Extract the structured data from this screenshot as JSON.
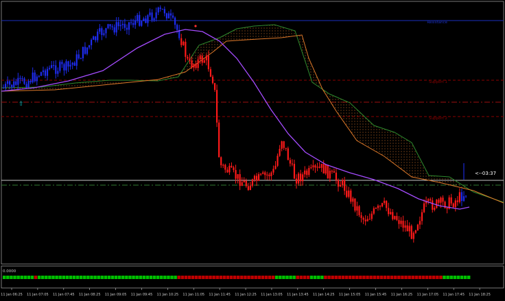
{
  "chart_data": {
    "type": "candlestick",
    "platform_style": "MetaTrader-like dark chart",
    "time_axis_labels": [
      "11 Jan 06:25",
      "11 Jan 07:05",
      "11 Jan 07:45",
      "11 Jan 08:25",
      "11 Jan 09:05",
      "11 Jan 09:45",
      "11 Jan 10:25",
      "11 Jan 11:05",
      "11 Jan 11:45",
      "11 Jan 12:25",
      "11 Jan 13:05",
      "11 Jan 13:45",
      "11 Jan 14:25",
      "11 Jan 15:05",
      "11 Jan 15:45",
      "11 Jan 16:25",
      "11 Jan 17:05",
      "11 Jan 17:45",
      "11 Jan 18:25"
    ],
    "horizontal_lines": [
      {
        "label": "Resistance",
        "color": "#1a2fc0",
        "style": "solid",
        "level": "upper"
      },
      {
        "label": "Support 1",
        "color": "#8b0000",
        "style": "dashed",
        "level": "mid"
      },
      {
        "label": "",
        "color": "#a01010",
        "style": "dashdot",
        "level": "mid2"
      },
      {
        "label": "Support 2",
        "color": "#8b0000",
        "style": "dashed",
        "level": "mid3"
      },
      {
        "label": "",
        "color": "#c8c8c8",
        "style": "solid",
        "level": "current"
      },
      {
        "label": "",
        "color": "#2f7a2f",
        "style": "dashdot",
        "level": "lower"
      }
    ],
    "countdown_label": "<--03:37",
    "indicator_pane": {
      "value_label": "0.0000",
      "segments": [
        {
          "color": "#00c000",
          "count": 9
        },
        {
          "color": "#c00000",
          "count": 1
        },
        {
          "color": "#00c000",
          "count": 40
        },
        {
          "color": "#c00000",
          "count": 28
        },
        {
          "color": "#00c000",
          "count": 6
        },
        {
          "color": "#c00000",
          "count": 4
        },
        {
          "color": "#00c000",
          "count": 4
        },
        {
          "color": "#c00000",
          "count": 34
        },
        {
          "color": "#00c000",
          "count": 8
        }
      ]
    },
    "colors": {
      "background": "#000000",
      "bull_candle": "#1e2cf0",
      "bear_candle": "#ff1a1a",
      "moving_average": "#a54cff",
      "cloud_up_line": "#2e8b2e",
      "cloud_down_line": "#e07a2a",
      "axis": "#c8c8c8"
    }
  }
}
